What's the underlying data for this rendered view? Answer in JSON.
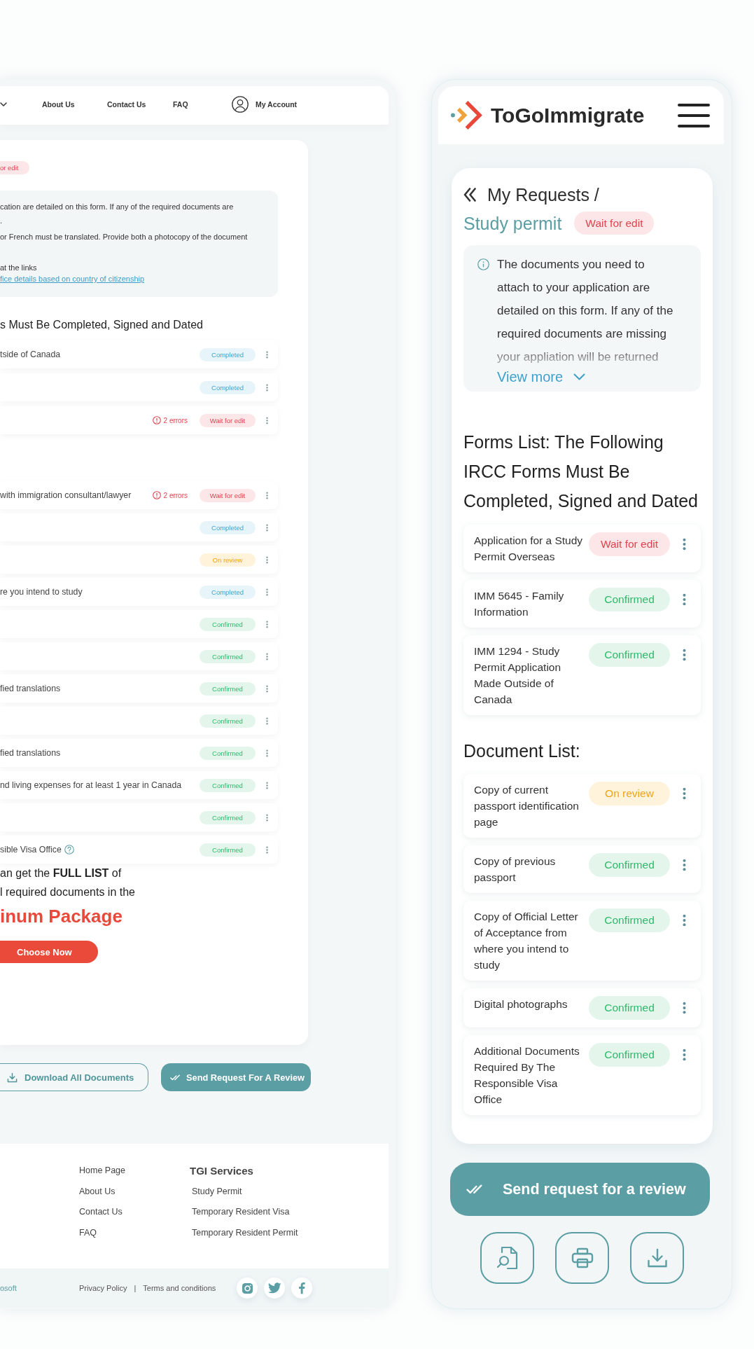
{
  "desktop": {
    "nav": {
      "items": [
        "About Us",
        "Contact Us",
        "FAQ"
      ],
      "account": "My Account"
    },
    "request_status": {
      "label": "or edit",
      "kind": "wait"
    },
    "info": {
      "lines": [
        "cation are detailed on this form. If any of the required documents are",
        ".",
        "or French must be translated. Provide both a photocopy of the document",
        "at the links"
      ],
      "link": "fice details based on country of citizenship"
    },
    "forms_heading": "s Must Be Completed, Signed and Dated",
    "forms": [
      {
        "title": "tside of Canada",
        "kind": "completed",
        "badge": "Completed"
      },
      {
        "kind": "completed",
        "badge": "Completed"
      },
      {
        "errors": "2 errors",
        "kind": "wait",
        "badge": "Wait for edit"
      }
    ],
    "documents": [
      {
        "title": "with immigration consultant/lawyer",
        "errors": "2 errors",
        "kind": "wait",
        "badge": "Wait for edit"
      },
      {
        "kind": "completed",
        "badge": "Completed"
      },
      {
        "kind": "review",
        "badge": "On review"
      },
      {
        "title": "re you intend to study",
        "kind": "completed",
        "badge": "Completed"
      },
      {
        "kind": "confirmed",
        "badge": "Confirmed"
      },
      {
        "kind": "confirmed",
        "badge": "Confirmed"
      },
      {
        "title": "fied translations",
        "kind": "confirmed",
        "badge": "Confirmed"
      },
      {
        "kind": "confirmed",
        "badge": "Confirmed"
      },
      {
        "title": "fied translations",
        "kind": "confirmed",
        "badge": "Confirmed"
      },
      {
        "title": "nd living expenses for at least 1 year in Canada",
        "kind": "confirmed",
        "badge": "Confirmed"
      },
      {
        "kind": "confirmed",
        "badge": "Confirmed"
      },
      {
        "title": "sible Visa Office",
        "help": true,
        "kind": "confirmed",
        "badge": "Confirmed"
      }
    ],
    "promo": {
      "lines": [
        "an get the **FULL LIST** of",
        "l required documents in the"
      ],
      "package": "inum Package",
      "button": "Choose Now"
    },
    "actions": {
      "download": "Download All Documents",
      "review": "Send Request For A Review"
    },
    "footer": {
      "links": [
        "Home Page",
        "About Us",
        "Contact Us",
        "FAQ"
      ],
      "services_title": "TGI Services",
      "services": [
        "Study Permit",
        "Temporary Resident Visa",
        "Temporary Resident Permit"
      ],
      "copyright": "osoft",
      "privacy": "Privacy Policy",
      "separator": "|",
      "terms": "Terms and conditions"
    }
  },
  "mobile": {
    "brand": "ToGoImmigrate",
    "breadcrumb": {
      "parent": "My Requests",
      "separator": "/",
      "current": "Study permit"
    },
    "request_status": {
      "label": "Wait for edit",
      "kind": "wait"
    },
    "info": {
      "text": "The documents you need to attach to your application are detailed on this form. If any of the required documents are missing your appliation will be returned",
      "more": "View more"
    },
    "forms_heading": "Forms List: The Following IRCC Forms Must Be Completed, Signed and Dated",
    "forms": [
      {
        "title": "Application for a Study Permit Overseas",
        "kind": "wait",
        "badge": "Wait for edit"
      },
      {
        "title": "IMM 5645 - Family Information",
        "kind": "confirmed",
        "badge": "Confirmed"
      },
      {
        "title": "IMM 1294 - Study Permit Application Made Outside of Canada",
        "kind": "confirmed",
        "badge": "Confirmed"
      }
    ],
    "documents_heading": "Document List:",
    "documents": [
      {
        "title": "Copy of current passport identification page",
        "kind": "review",
        "badge": "On review"
      },
      {
        "title": "Copy of previous passport",
        "kind": "confirmed",
        "badge": "Confirmed"
      },
      {
        "title": "Copy of Official Letter of Acceptance from where you intend to study",
        "kind": "confirmed",
        "badge": "Confirmed"
      },
      {
        "title": "Digital photographs",
        "kind": "confirmed",
        "badge": "Confirmed"
      },
      {
        "title": "Additional Documents Required By The Responsible Visa Office",
        "kind": "confirmed",
        "badge": "Confirmed"
      }
    ],
    "review_button": "Send request for a review"
  }
}
